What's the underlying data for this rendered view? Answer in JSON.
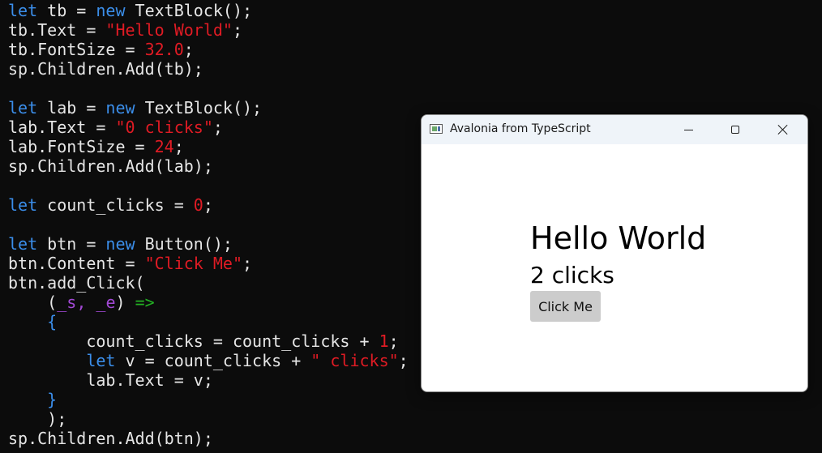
{
  "code": {
    "l1": {
      "kw1": "let",
      "a": " tb = ",
      "kw2": "new",
      "b": " TextBlock();"
    },
    "l2": {
      "a": "tb.Text = ",
      "str": "\"Hello World\"",
      "b": ";"
    },
    "l3": {
      "a": "tb.FontSize = ",
      "num": "32.0",
      "b": ";"
    },
    "l4": {
      "a": "sp.Children.Add(tb);"
    },
    "l6": {
      "kw1": "let",
      "a": " lab = ",
      "kw2": "new",
      "b": " TextBlock();"
    },
    "l7": {
      "a": "lab.Text = ",
      "str": "\"0 clicks\"",
      "b": ";"
    },
    "l8": {
      "a": "lab.FontSize = ",
      "num": "24",
      "b": ";"
    },
    "l9": {
      "a": "sp.Children.Add(lab);"
    },
    "l11": {
      "kw1": "let",
      "a": " count_clicks = ",
      "num": "0",
      "b": ";"
    },
    "l13": {
      "kw1": "let",
      "a": " btn = ",
      "kw2": "new",
      "b": " Button();"
    },
    "l14": {
      "a": "btn.Content = ",
      "str": "\"Click Me\"",
      "b": ";"
    },
    "l15": {
      "a": "btn.add_Click("
    },
    "l16": {
      "indent": "    (",
      "p1": "_s",
      "sep": ", ",
      "p2": "_e",
      "mid": ") ",
      "arrow": "=>"
    },
    "l17": {
      "indent": "    ",
      "brace": "{"
    },
    "l18": {
      "a": "        count_clicks = count_clicks + ",
      "num": "1",
      "b": ";"
    },
    "l19": {
      "indent": "        ",
      "kw1": "let",
      "a": " v = count_clicks + ",
      "str": "\" clicks\"",
      "b": ";"
    },
    "l20": {
      "a": "        lab.Text = v;"
    },
    "l21": {
      "indent": "    ",
      "brace": "}"
    },
    "l22": {
      "a": "    );"
    },
    "l23": {
      "a": "sp.Children.Add(btn);"
    }
  },
  "window": {
    "title": "Avalonia from TypeScript",
    "icon": "app-window-icon",
    "controls": [
      "minimize-icon",
      "maximize-icon",
      "close-icon"
    ],
    "hello_text": "Hello World",
    "clicks_text": "2 clicks",
    "button_label": "Click Me"
  },
  "colors": {
    "background": "#0c0c0c",
    "keyword": "#3b8eea",
    "string": "#e01b24",
    "param": "#a349d6",
    "arrow": "#23b123",
    "titlebar": "#eff4f9",
    "button": "#cccccc"
  }
}
